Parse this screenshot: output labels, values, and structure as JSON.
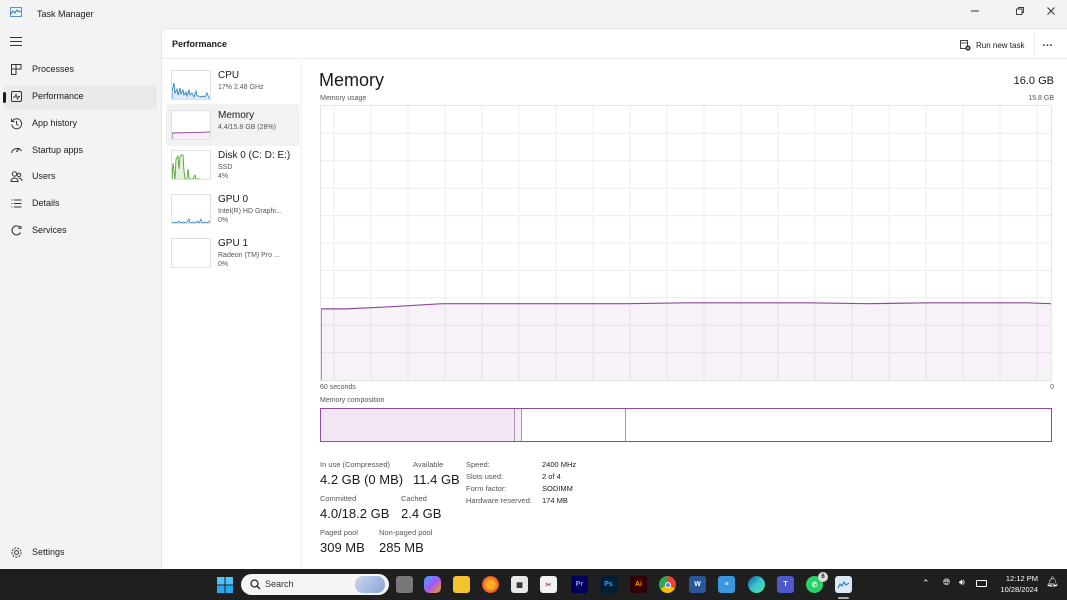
{
  "window": {
    "title": "Task Manager",
    "controls": [
      "minimize",
      "restore",
      "close"
    ]
  },
  "sidebar": {
    "items": [
      {
        "label": "Processes",
        "icon": "processes-icon"
      },
      {
        "label": "Performance",
        "icon": "performance-icon",
        "active": true
      },
      {
        "label": "App history",
        "icon": "app-history-icon"
      },
      {
        "label": "Startup apps",
        "icon": "startup-apps-icon"
      },
      {
        "label": "Users",
        "icon": "users-icon"
      },
      {
        "label": "Details",
        "icon": "details-icon"
      },
      {
        "label": "Services",
        "icon": "services-icon"
      }
    ],
    "settings_label": "Settings"
  },
  "header": {
    "title": "Performance",
    "run_new_task": "Run new task",
    "more": "…"
  },
  "devices": [
    {
      "name": "CPU",
      "sub1": "17%  2.48 GHz",
      "sub2": "",
      "color": "#1f7ab8"
    },
    {
      "name": "Memory",
      "sub1": "4.4/15.8 GB (28%)",
      "sub2": "",
      "color": "#8e4a9c",
      "active": true
    },
    {
      "name": "Disk 0 (C: D: E:)",
      "sub1": "SSD",
      "sub2": "4%",
      "color": "#4b9a2a"
    },
    {
      "name": "GPU 0",
      "sub1": "Intel(R) HD Graphi...",
      "sub2": "0%",
      "color": "#1f7ab8"
    },
    {
      "name": "GPU 1",
      "sub1": "Radeon (TM) Pro ...",
      "sub2": "0%",
      "color": "#1f7ab8"
    }
  ],
  "memory": {
    "title": "Memory",
    "total": "16.0 GB",
    "usage_label": "Memory usage",
    "max_label": "15.8 GB",
    "axis_left": "60 seconds",
    "axis_right": "0",
    "composition_label": "Memory composition",
    "stats": [
      {
        "key": "In use (Compressed)",
        "value": "4.2 GB (0 MB)"
      },
      {
        "key": "Available",
        "value": "11.4 GB"
      },
      {
        "key": "Committed",
        "value": "4.0/18.2 GB"
      },
      {
        "key": "Cached",
        "value": "2.4 GB"
      },
      {
        "key": "Paged pool",
        "value": "309 MB"
      },
      {
        "key": "Non-paged pool",
        "value": "285 MB"
      }
    ],
    "specs": [
      {
        "key": "Speed:",
        "value": "2400 MHz"
      },
      {
        "key": "Slots used:",
        "value": "2 of 4"
      },
      {
        "key": "Form factor:",
        "value": "SODIMM"
      },
      {
        "key": "Hardware reserved:",
        "value": "174 MB"
      }
    ],
    "accent": "#8e4a9c"
  },
  "chart_data": {
    "type": "area",
    "title": "Memory usage",
    "xlabel": "",
    "ylabel": "",
    "x_range": [
      60,
      0
    ],
    "ylim": [
      0,
      15.8
    ],
    "grid": true,
    "series": [
      {
        "name": "Memory in use (GB)",
        "x": [
          60,
          58,
          55,
          50,
          47,
          45,
          40,
          35,
          30,
          25,
          20,
          15,
          10,
          5,
          2,
          0
        ],
        "values": [
          4.1,
          4.1,
          4.2,
          4.4,
          4.4,
          4.4,
          4.4,
          4.4,
          4.45,
          4.45,
          4.45,
          4.4,
          4.45,
          4.45,
          4.45,
          4.4
        ]
      }
    ],
    "composition": {
      "total_gb": 15.8,
      "in_use_gb": 4.2,
      "modified_gb": 0.15,
      "standby_gb": 2.25,
      "free_gb": 9.2
    }
  },
  "taskbar": {
    "search_label": "Search",
    "apps": [
      "start",
      "search",
      "task-view",
      "copilot",
      "file-explorer",
      "firefox",
      "calendar-app",
      "snipping-tool",
      "premiere-pro",
      "photoshop",
      "illustrator",
      "chrome",
      "word",
      "notepad",
      "edge",
      "teams",
      "whatsapp",
      "task-manager"
    ],
    "whatsapp_badge": "6",
    "time": "12:12 PM",
    "date": "10/28/2024"
  }
}
